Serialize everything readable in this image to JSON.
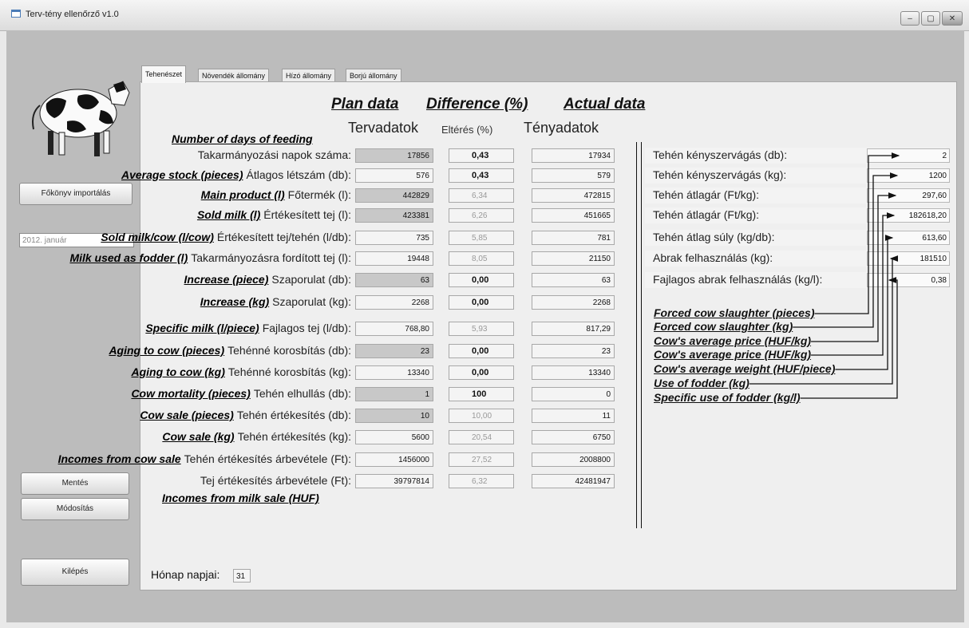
{
  "window": {
    "title": "Terv-tény ellenőrző v1.0",
    "controls": [
      "–",
      "▢",
      "✕"
    ]
  },
  "sidebar": {
    "import_button": "Főkönyv importálás",
    "date_value": "2012. január",
    "save_button": "Mentés",
    "modify_button": "Módosítás",
    "exit_button": "Kilépés"
  },
  "tabs": [
    "Tehenészet",
    "Növendék állomány",
    "Hízó állomány",
    "Borjú állomány"
  ],
  "headers": {
    "plan_en": "Plan data",
    "diff_en": "Difference (%)",
    "actual_en": "Actual data",
    "plan_hu": "Tervadatok",
    "diff_hu": "Eltérés (%)",
    "actual_hu": "Tényadatok"
  },
  "rows": [
    {
      "en_above": "Number of days of feeding",
      "hu": "Takarmányozási napok száma:",
      "plan": "17856",
      "diff": "0,43",
      "actual": "17934",
      "plan_gray": true,
      "diff_bold": true
    },
    {
      "en": "Average stock (pieces)",
      "hu": "Átlagos létszám (db):",
      "plan": "576",
      "diff": "0,43",
      "actual": "579",
      "plan_gray": false,
      "diff_bold": true
    },
    {
      "en": "Main product (l)",
      "hu": "Főtermék (l):",
      "plan": "442829",
      "diff": "6,34",
      "actual": "472815",
      "plan_gray": true,
      "diff_bold": false
    },
    {
      "en": "Sold milk (l)",
      "hu": "Értékesített tej (l):",
      "plan": "423381",
      "diff": "6,26",
      "actual": "451665",
      "plan_gray": true,
      "diff_bold": false
    },
    {
      "en": "Sold milk/cow (l/cow)",
      "hu": "Értékesített tej/tehén (l/db):",
      "plan": "735",
      "diff": "5,85",
      "actual": "781",
      "plan_gray": false,
      "diff_bold": false
    },
    {
      "en": "Milk used as fodder (l)",
      "hu": "Takarmányozásra fordított tej (l):",
      "plan": "19448",
      "diff": "8,05",
      "actual": "21150",
      "plan_gray": false,
      "diff_bold": false
    },
    {
      "en": "Increase (piece)",
      "hu": "Szaporulat (db):",
      "plan": "63",
      "diff": "0,00",
      "actual": "63",
      "plan_gray": true,
      "diff_bold": true
    },
    {
      "en": "Increase (kg)",
      "hu": "Szaporulat (kg):",
      "plan": "2268",
      "diff": "0,00",
      "actual": "2268",
      "plan_gray": false,
      "diff_bold": true
    },
    {
      "en": "Specific milk (l/piece)",
      "hu": "Fajlagos tej (l/db):",
      "plan": "768,80",
      "diff": "5,93",
      "actual": "817,29",
      "plan_gray": false,
      "diff_bold": false
    },
    {
      "en": "Aging to cow (pieces)",
      "hu": "Tehénné korosbítás (db):",
      "plan": "23",
      "diff": "0,00",
      "actual": "23",
      "plan_gray": true,
      "diff_bold": true
    },
    {
      "en": "Aging to cow (kg)",
      "hu": "Tehénné korosbítás (kg):",
      "plan": "13340",
      "diff": "0,00",
      "actual": "13340",
      "plan_gray": false,
      "diff_bold": true
    },
    {
      "en": "Cow mortality (pieces)",
      "hu": "Tehén elhullás (db):",
      "plan": "1",
      "diff": "100",
      "actual": "0",
      "plan_gray": true,
      "diff_bold": true
    },
    {
      "en": "Cow sale (pieces)",
      "hu": "Tehén értékesítés (db):",
      "plan": "10",
      "diff": "10,00",
      "actual": "11",
      "plan_gray": true,
      "diff_bold": false
    },
    {
      "en": "Cow sale (kg)",
      "hu": "Tehén értékesítés (kg):",
      "plan": "5600",
      "diff": "20,54",
      "actual": "6750",
      "plan_gray": false,
      "diff_bold": false
    },
    {
      "en": "Incomes from cow sale",
      "hu": "Tehén értékesítés árbevétele (Ft):",
      "plan": "1456000",
      "diff": "27,52",
      "actual": "2008800",
      "plan_gray": false,
      "diff_bold": false
    },
    {
      "en_below": "Incomes from milk sale (HUF)",
      "hu": "Tej értékesítés árbevétele (Ft):",
      "plan": "39797814",
      "diff": "6,32",
      "actual": "42481947",
      "plan_gray": false,
      "diff_bold": false
    }
  ],
  "right_rows": [
    {
      "hu": "Tehén kényszervágás (db):",
      "value": "2",
      "en": "Forced cow slaughter (pieces)"
    },
    {
      "hu": "Tehén kényszervágás (kg):",
      "value": "1200",
      "en": "Forced cow slaughter (kg)"
    },
    {
      "hu": "Tehén átlagár (Ft/kg):",
      "value": "297,60",
      "en": "Cow's average price (HUF/kg)"
    },
    {
      "hu": "Tehén átlagár (Ft/kg):",
      "value": "182618,20",
      "en": "Cow's average price (HUF/kg)"
    },
    {
      "hu": "Tehén átlag súly (kg/db):",
      "value": "613,60",
      "en": "Cow's average weight (HUF/piece)"
    },
    {
      "hu": "Abrak felhasználás (kg):",
      "value": "181510",
      "en": "Use of fodder (kg)"
    },
    {
      "hu": "Fajlagos abrak felhasználás (kg/l):",
      "value": "0,38",
      "en": "Specific use of fodder (kg/l)"
    }
  ],
  "footer": {
    "days_label": "Hónap napjai:",
    "days_value": "31"
  }
}
